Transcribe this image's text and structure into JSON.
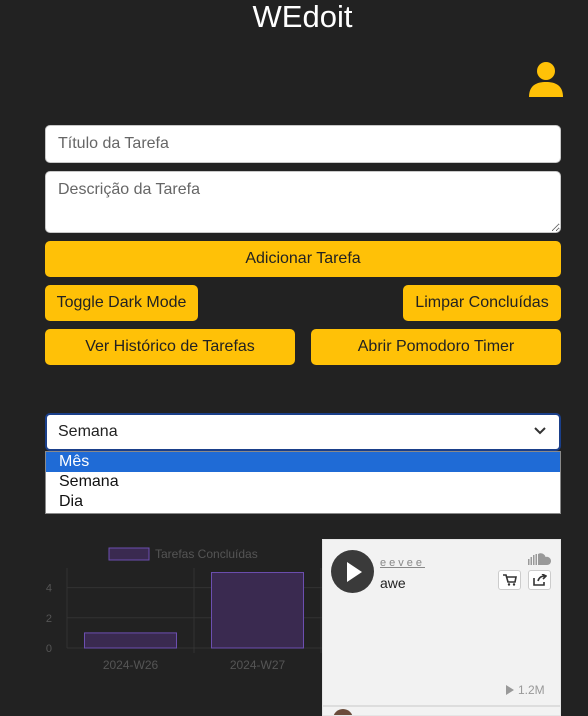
{
  "app": {
    "title": "WEdoit"
  },
  "form": {
    "title_placeholder": "Título da Tarefa",
    "description_placeholder": "Descrição da Tarefa"
  },
  "buttons": {
    "add_task": "Adicionar Tarefa",
    "toggle_dark": "Toggle Dark Mode",
    "clear_done": "Limpar Concluídas",
    "history": "Ver Histórico de Tarefas",
    "pomodoro": "Abrir Pomodoro Timer"
  },
  "period_select": {
    "selected": "Semana",
    "options": [
      "Mês",
      "Semana",
      "Dia"
    ],
    "highlighted": "Mês"
  },
  "chart_data": {
    "type": "bar",
    "categories": [
      "2024-W26",
      "2024-W27"
    ],
    "series": [
      {
        "name": "Tarefas Concluídas",
        "values": [
          1,
          5
        ]
      }
    ],
    "yticks": [
      "0",
      "2",
      "4"
    ],
    "ylim": [
      0,
      5.3
    ],
    "xlabel": "",
    "ylabel": "",
    "legend_position": "top",
    "colors": {
      "bar_fill": "#3a2a50",
      "bar_stroke": "#6c4fb0",
      "text": "#555555",
      "grid": "#333333"
    }
  },
  "soundcloud": {
    "artist": "eevee",
    "track": "awe",
    "plays": "1.2M",
    "icons": [
      "play-icon",
      "soundcloud-logo-icon",
      "cart-icon",
      "share-icon"
    ]
  },
  "colors": {
    "background": "#222222",
    "accent": "#ffc107",
    "selected_option": "#1f6bd6",
    "user_icon": "#ffc107"
  }
}
